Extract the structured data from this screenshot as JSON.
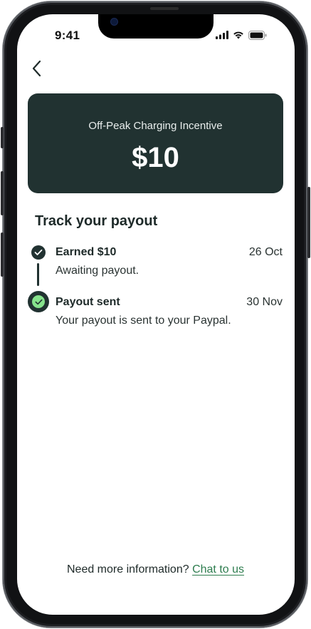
{
  "status_bar": {
    "time": "9:41",
    "icons": [
      "signal-icon",
      "wifi-icon",
      "battery-icon"
    ]
  },
  "nav": {
    "back_icon": "chevron-left-icon"
  },
  "card": {
    "title": "Off-Peak Charging Incentive",
    "amount": "$10",
    "background": "#213231"
  },
  "payout": {
    "title": "Track your payout",
    "steps": [
      {
        "title": "Earned $10",
        "date": "26 Oct",
        "description": "Awaiting payout.",
        "icon": "check-circle-icon"
      },
      {
        "title": "Payout sent",
        "date": "30 Nov",
        "description": "Your payout is sent to your Paypal.",
        "icon": "check-circle-active-icon"
      }
    ]
  },
  "footer": {
    "prompt": "Need more information?",
    "link": "Chat to us",
    "link_color": "#2e7d4f"
  },
  "colors": {
    "accent_green": "#86e38c",
    "dark": "#213231"
  }
}
